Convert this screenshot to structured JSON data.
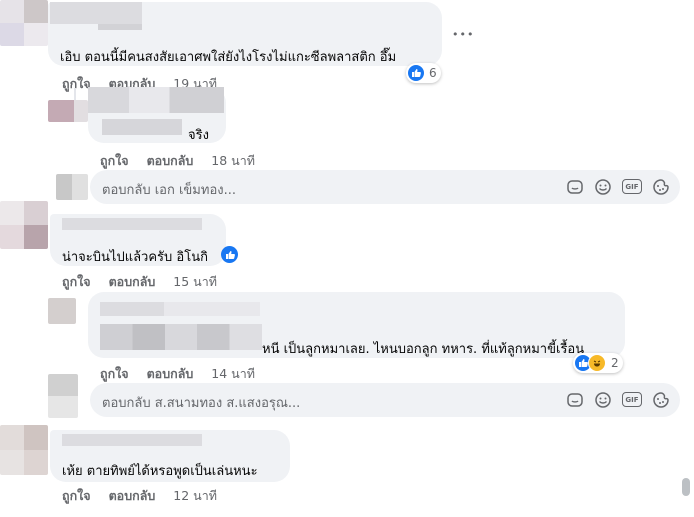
{
  "comments": [
    {
      "text": "เอิบ ตอนนี้มีคนสงสัยเอาศพใส่ยังไงโรงไม่แกะซีลพลาสติก อึ๊ม",
      "like_label": "ถูกใจ",
      "reply_label": "ตอบกลับ",
      "time": "19 นาที",
      "reaction_count": "6",
      "more_label": "•••"
    },
    {
      "text": "จริง",
      "like_label": "ถูกใจ",
      "reply_label": "ตอบกลับ",
      "time": "18 นาที"
    },
    {
      "text": "น่าจะบินไปแล้วครับ อิโนกิ",
      "like_label": "ถูกใจ",
      "reply_label": "ตอบกลับ",
      "time": "15 นาที"
    },
    {
      "text": "หนี เป็นลูกหมาเลย. ไหนบอกลูก ทหาร. ที่แท้ลูกหมาขี้เรื้อน",
      "like_label": "ถูกใจ",
      "reply_label": "ตอบกลับ",
      "time": "14 นาที",
      "reaction_count": "2"
    },
    {
      "text": "เห้ย ตายทิพย์ได้หรอพูดเป็นเล่นหนะ",
      "like_label": "ถูกใจ",
      "reply_label": "ตอบกลับ",
      "time": "12 นาที"
    }
  ],
  "reply_boxes": [
    {
      "placeholder": "ตอบกลับ เอก เข็มทอง..."
    },
    {
      "placeholder": "ตอบกลับ ส.สนามทอง ส.แสงอรุณ..."
    }
  ],
  "icons": [
    "sticker-icon",
    "emoji-icon",
    "gif-icon",
    "avatar-sticker-icon"
  ],
  "gif_text": "GIF",
  "colors": {
    "like": "#1877f2",
    "bubble": "#f0f2f5",
    "meta": "#65676b"
  }
}
